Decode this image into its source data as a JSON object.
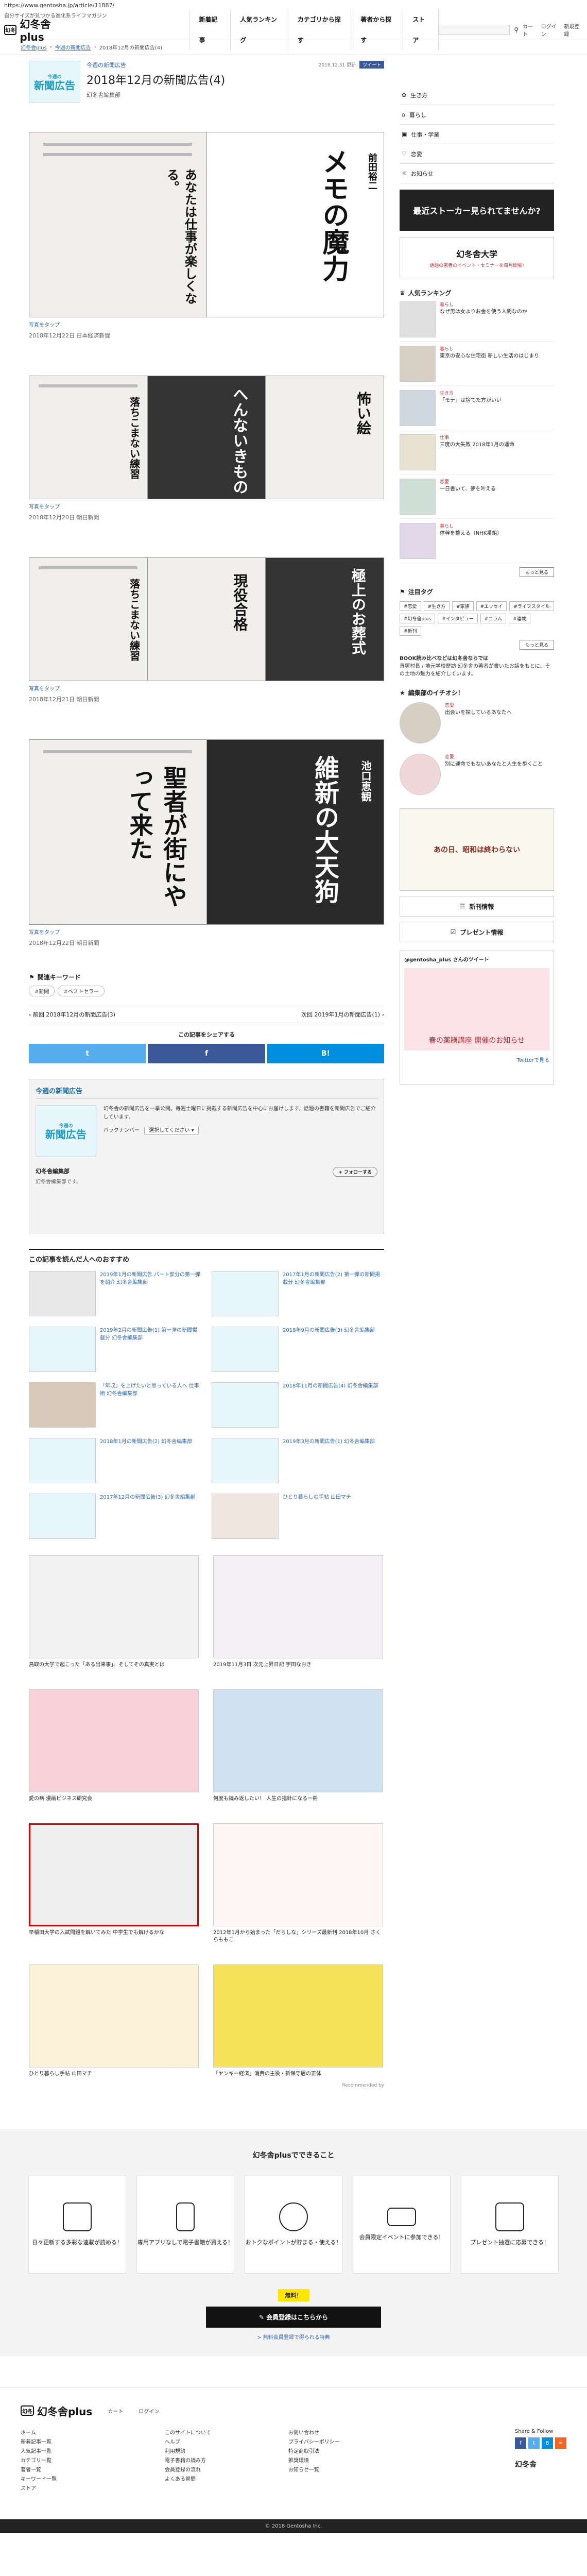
{
  "browser": {
    "url": "https://www.gentosha.jp/article/11887/"
  },
  "site": {
    "tagline": "自分サイズが見つかる進化系ライフマガジン",
    "logo_mark": "幻冬",
    "logo_text": "幻冬舎plus",
    "nav": [
      "新着記事",
      "人気ランキング",
      "カテゴリから探す",
      "著者から探す",
      "ストア"
    ],
    "tools": [
      "カート",
      "ログイン",
      "新規登録"
    ]
  },
  "breadcrumb": {
    "items": [
      "幻冬舎plus",
      "今週の新聞広告",
      "2018年12月の新聞広告(4)"
    ]
  },
  "article": {
    "series": "今週の新聞広告",
    "title": "2018年12月の新聞広告(4)",
    "author": "幻冬舎編集部",
    "published": "2018.12.31 更新",
    "share_tag": "ツイート",
    "thumb_top": "今週の",
    "thumb_big": "新聞広告",
    "ads": [
      {
        "caption": "写真をタップ",
        "date": "2018年12月22日 日本経済新聞",
        "headlines": [
          "あなたは仕事が楽しくなる。",
          "メモの魔力",
          "前田裕二"
        ]
      },
      {
        "caption": "写真をタップ",
        "date": "2018年12月20日 朝日新聞",
        "headlines": [
          "落ちこまない練習",
          "へんないきもの",
          "怖い絵"
        ]
      },
      {
        "caption": "写真をタップ",
        "date": "2018年12月21日 朝日新聞",
        "headlines": [
          "落ちこまない練習",
          "現役合格",
          "極上のお葬式"
        ]
      },
      {
        "caption": "写真をタップ",
        "date": "2018年12月22日 朝日新聞",
        "headlines": [
          "聖者が街にやって来た",
          "維新の大天狗",
          "池口恵観"
        ]
      }
    ]
  },
  "keywords": {
    "title": "関連キーワード",
    "tags": [
      "#新聞",
      "#ベストセラー"
    ]
  },
  "pager": {
    "prev": "前回 2018年12月の新聞広告(3)",
    "next": "次回 2019年1月の新聞広告(1)"
  },
  "share": {
    "label": "この記事をシェアする",
    "buttons": [
      "t",
      "f",
      "B!"
    ]
  },
  "today_box": {
    "title": "今週の新聞広告",
    "desc": "幻冬舎の新聞広告を一挙公開。毎週土曜日に掲載する新聞広告を中心にお届けします。話題の書籍を新聞広告でご紹介しています。",
    "sort_label": "バックナンバー",
    "sort_select": "選択してください",
    "author_name": "幻冬舎編集部",
    "author_sub": "幻冬舎編集部です。",
    "follow": "+ フォローする"
  },
  "recommend": {
    "title": "この記事を読んだ人へのおすすめ",
    "items": [
      "2019年1月の新聞広告 パート部分の第一弾を紹介 幻冬舎編集部",
      "2017年1月の新聞広告(2) 第一弾の新聞掲載分 幻冬舎編集部",
      "2019年2月の新聞広告(1) 第一弾の新聞掲載分 幻冬舎編集部",
      "2018年9月の新聞広告(3) 幻冬舎編集部",
      "「年収」を上げたいと思っている人へ 仕事術 幻冬舎編集部",
      "2018年11月の新聞広告(4) 幻冬舎編集部",
      "2018年1月の新聞広告(2) 幻冬舎編集部",
      "2019年3月の新聞広告(1) 幻冬舎編集部",
      "2017年12月の新聞広告(3) 幻冬舎編集部",
      "ひとり暮らしの手帖 山田マチ"
    ]
  },
  "big_recs": [
    "鳥取の大学で起こった「ある出来事」。そしてその真実とは",
    "2019年11月3日 次元上昇日記 宇田なおき",
    "愛の病 漫画ビジネス研究会",
    "何度も読み返したい！ 人生の指針になる一冊",
    "早稲田大学の入試問題を解いてみた 中学生でも解けるかな",
    "2012年1月から始まった「だらしな」シリーズ最新刊 2018年10月 さくらももこ",
    "ひとり暮らし手帖 山田マチ",
    "「ヤンキー経済」消費の主役・新保守層の正体"
  ],
  "big_recs_footer": "Recommended by",
  "sidebar": {
    "menu": [
      "生き方",
      "暮らし",
      "仕事・学業",
      "恋愛",
      "お知らせ"
    ],
    "banner1": "最近ストーカー見られてませんか?",
    "banner2": "幻冬舎大学",
    "banner2_sub": "話題の著者のイベント・セミナーを毎月開催!",
    "ranking_title": "人気ランキング",
    "ranking": [
      {
        "cat": "暮らし",
        "text": "なぜ男は女よりお金を使う人間なのか"
      },
      {
        "cat": "暮らし",
        "text": "東京の安心な住宅街 新しい生活のはじまり"
      },
      {
        "cat": "生き方",
        "text": "「モテ」は捨てた方がいい"
      },
      {
        "cat": "仕事",
        "text": "三度の大失敗 2018年1月の運命"
      },
      {
        "cat": "恋愛",
        "text": "一日書いて、夢を叶える"
      },
      {
        "cat": "暮らし",
        "text": "体幹を整える（NHK番組）"
      }
    ],
    "more": "もっと見る",
    "tags_title": "注目タグ",
    "tags": [
      "#恋愛",
      "#生き方",
      "#家族",
      "#エッセイ",
      "#ライフスタイル",
      "#幻冬舎plus",
      "#インタビュー",
      "#コラム",
      "#連載",
      "#新刊"
    ],
    "event_title": "BOOK読み比べなどは幻冬舎ならでは",
    "event_text": "直塚村長 / 地元学校歴訪 幻冬舎の著者が書いたお話をもとに、その土地の魅力を紹介しています。",
    "feat_title": "編集部のイチオシ！",
    "feat": [
      {
        "cat": "恋愛",
        "text": "出会いを探しているあなたへ"
      },
      {
        "cat": "恋愛",
        "text": "別に運命でもないあなたと人生を歩くこと"
      }
    ],
    "side_ad": "あの日、昭和は終わらない",
    "btn_books": "新刊情報",
    "btn_present": "プレゼント情報",
    "twitter_handle": "@gentosha_plus さんのツイート",
    "twitter_text": "春の薬膳講座 開催のお知らせ",
    "twitter_follow": "Twitterで見る"
  },
  "can_do": {
    "title": "幻冬舎plusでできること",
    "cards": [
      "日々更新する多彩な連載が読める！",
      "専用アプリなしで電子書籍が買える！",
      "おトクなポイントが貯まる・使える！",
      "会員限定イベントに参加できる！",
      "プレゼント抽選に応募できる！"
    ],
    "pill": "無料！",
    "button": "会員登録はこちらから",
    "sub": "> 無料会員登録で得られる特典"
  },
  "footer": {
    "logo": "幻冬舎plus",
    "tools": [
      "カート",
      "ログイン"
    ],
    "col1": [
      "ホーム",
      "新着記事一覧",
      "人気記事一覧",
      "カテゴリ一覧",
      "著者一覧",
      "キーワード一覧",
      "ストア"
    ],
    "col2": [
      "このサイトについて",
      "ヘルプ",
      "利用規約",
      "電子書籍の読み方",
      "会員登録の流れ",
      "よくある質問"
    ],
    "col3": [
      "お問い合わせ",
      "プライバシーポリシー",
      "特定商取引法",
      "推奨環境",
      "お知らせ一覧"
    ],
    "share_label": "Share & Follow",
    "company": "幻冬舎",
    "copyright": "© 2018 Gentosha Inc."
  },
  "colors": {
    "link": "#2a66b8",
    "facebook": "#3b5998",
    "twitter": "#55acee",
    "hatena": "#008fde",
    "accent": "#1a9bc4"
  }
}
